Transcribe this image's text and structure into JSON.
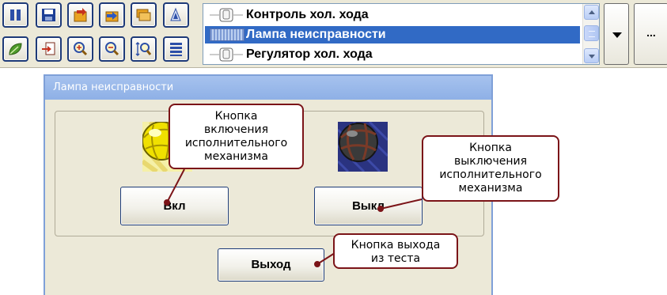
{
  "toolbar": {
    "icons": [
      "pause-icon",
      "save-icon",
      "import-icon",
      "export-icon",
      "folders-icon",
      "tree-icon",
      "leaf-icon",
      "move-icon",
      "zoom-in-icon",
      "zoom-out-icon",
      "zoom-height-icon",
      "list-icon"
    ]
  },
  "signal_list": {
    "items": [
      {
        "label": "Контроль хол. хода",
        "icon": "lamp-off-icon",
        "selected": false
      },
      {
        "label": "Лампа неисправности",
        "icon": "lamp-pattern-icon",
        "selected": true
      },
      {
        "label": "Регулятор хол. хода",
        "icon": "lamp-off-icon",
        "selected": false
      }
    ],
    "more_label": "..."
  },
  "dialog": {
    "title": "Лампа неисправности",
    "on_label": "Вкл",
    "off_label": "Выкл",
    "exit_label": "Выход"
  },
  "callouts": {
    "on_button": [
      "Кнопка",
      "включения",
      "исполнительного",
      "механизма"
    ],
    "off_button": [
      "Кнопка",
      "выключения",
      "исполнительного",
      "механизма"
    ],
    "exit_button": [
      "Кнопка выхода",
      "из теста"
    ]
  },
  "colors": {
    "selection": "#316ac5",
    "dialog_title": "#8eb0e6",
    "callout_border": "#7b1418",
    "button_border": "#1f3d7a"
  }
}
